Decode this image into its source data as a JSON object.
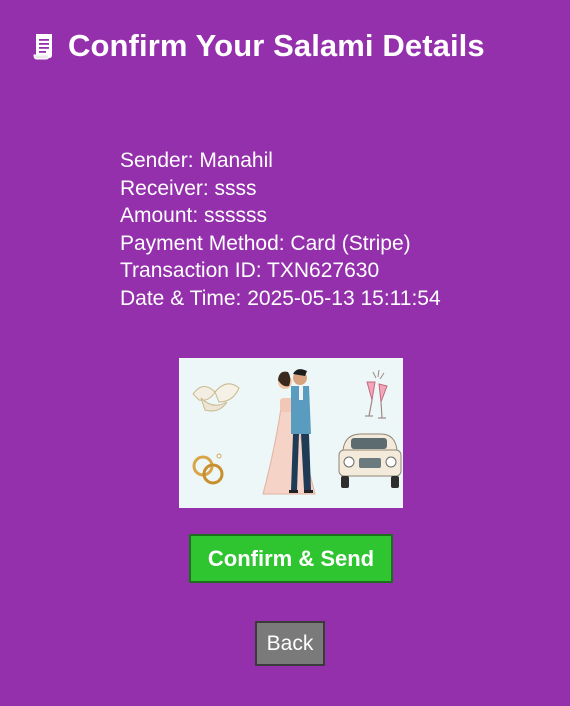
{
  "header": {
    "title": "Confirm Your Salami Details",
    "icon": "receipt-icon"
  },
  "details": {
    "sender": "Sender: Manahil",
    "receiver": "Receiver: ssss",
    "amount": "Amount: ssssss",
    "payment_method": "Payment Method: Card (Stripe)",
    "transaction_id": "Transaction ID: TXN627630",
    "date_time": "Date & Time: 2025-05-13 15:11:54"
  },
  "illustration": {
    "description_icon": "wedding-illustration"
  },
  "actions": {
    "confirm_label": "Confirm & Send",
    "back_label": "Back"
  },
  "colors": {
    "background": "#9530ad",
    "confirm_button": "#2fc531",
    "back_button": "#7a7a7a"
  }
}
